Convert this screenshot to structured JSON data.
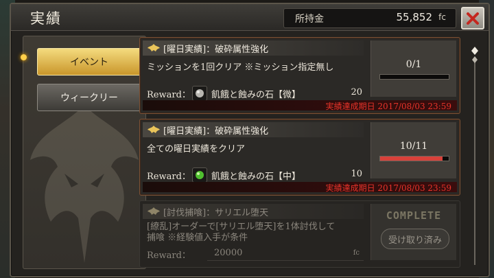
{
  "window": {
    "title": "実績"
  },
  "money": {
    "label": "所持金",
    "value": "55,852",
    "unit": "fc"
  },
  "colors": {
    "accent_gold": "#e9c45a",
    "deadline_red": "#e8332a",
    "progress_red": "#d8413a"
  },
  "tabs": [
    {
      "label": "イベント",
      "active": true
    },
    {
      "label": "ウィークリー",
      "active": false
    }
  ],
  "achievements": [
    {
      "title": "[曜日実績]：破砕属性強化",
      "description": "ミッションを1回クリア ※ミッション指定無し",
      "reward_label": "Reward：",
      "reward_item": "飢餓と蝕みの石【微】",
      "reward_qty": "20",
      "item_icon": "gray-stone-icon",
      "progress_text": "0/1",
      "progress_fraction": 0.0,
      "deadline": "実績達成期日 2017/08/03 23:59"
    },
    {
      "title": "[曜日実績]：破砕属性強化",
      "description": "全ての曜日実績をクリア",
      "reward_label": "Reward：",
      "reward_item": "飢餓と蝕みの石【中】",
      "reward_qty": "10",
      "item_icon": "green-stone-icon",
      "progress_text": "10/11",
      "progress_fraction": 0.909,
      "deadline": "実績達成期日 2017/08/03 23:59"
    },
    {
      "title": "[討伐捕喰]：サリエル堕天",
      "description_line1": "[繚乱]オーダーで[サリエル堕天]を1体討伐して",
      "description_line2": "捕喰 ※経験値入手が条件",
      "reward_label": "Reward：",
      "reward_amount": "20000",
      "reward_unit": "fc",
      "status": "COMPLETE",
      "button_label": "受け取り済み"
    }
  ]
}
